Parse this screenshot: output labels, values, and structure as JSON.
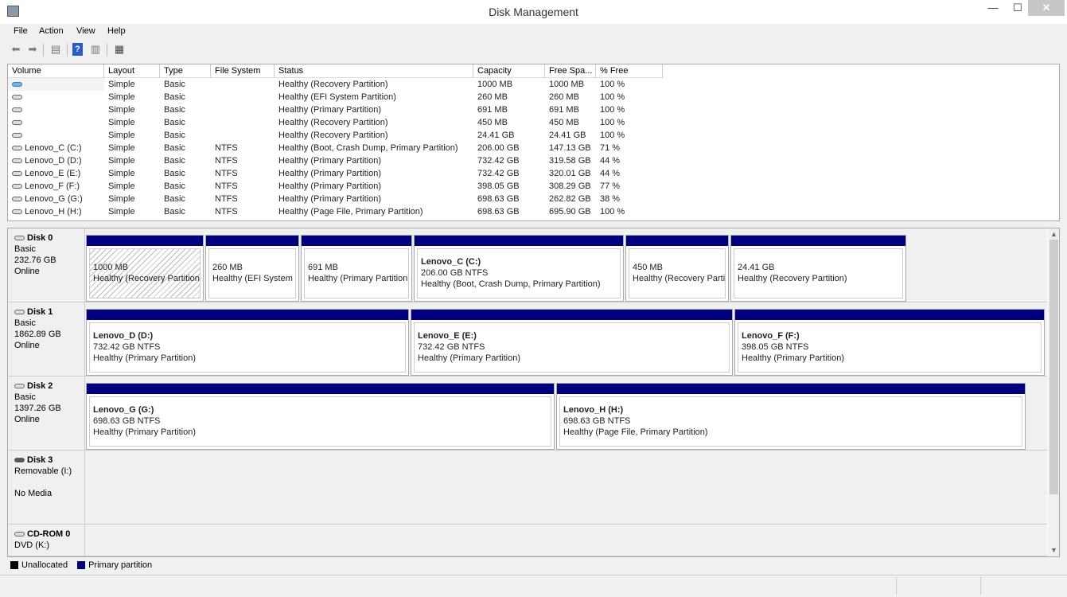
{
  "window": {
    "title": "Disk Management",
    "minimize": "—",
    "maximize": "☐",
    "close": "✕"
  },
  "menu": [
    "File",
    "Action",
    "View",
    "Help"
  ],
  "toolbar": [
    {
      "icon": "back-arrow-icon"
    },
    {
      "icon": "forward-arrow-icon"
    },
    {
      "icon": "console-tree-icon"
    },
    {
      "icon": "help-icon"
    },
    {
      "icon": "action-pane-icon"
    },
    {
      "icon": "properties-icon"
    }
  ],
  "columns": [
    "Volume",
    "Layout",
    "Type",
    "File System",
    "Status",
    "Capacity",
    "Free Spa...",
    "% Free"
  ],
  "volumes": [
    [
      "",
      "Simple",
      "Basic",
      "",
      "Healthy (Recovery Partition)",
      "1000 MB",
      "1000 MB",
      "100 %"
    ],
    [
      "",
      "Simple",
      "Basic",
      "",
      "Healthy (EFI System Partition)",
      "260 MB",
      "260 MB",
      "100 %"
    ],
    [
      "",
      "Simple",
      "Basic",
      "",
      "Healthy (Primary Partition)",
      "691 MB",
      "691 MB",
      "100 %"
    ],
    [
      "",
      "Simple",
      "Basic",
      "",
      "Healthy (Recovery Partition)",
      "450 MB",
      "450 MB",
      "100 %"
    ],
    [
      "",
      "Simple",
      "Basic",
      "",
      "Healthy (Recovery Partition)",
      "24.41 GB",
      "24.41 GB",
      "100 %"
    ],
    [
      "Lenovo_C (C:)",
      "Simple",
      "Basic",
      "NTFS",
      "Healthy (Boot, Crash Dump, Primary Partition)",
      "206.00 GB",
      "147.13 GB",
      "71 %"
    ],
    [
      "Lenovo_D (D:)",
      "Simple",
      "Basic",
      "NTFS",
      "Healthy (Primary Partition)",
      "732.42 GB",
      "319.58 GB",
      "44 %"
    ],
    [
      "Lenovo_E (E:)",
      "Simple",
      "Basic",
      "NTFS",
      "Healthy (Primary Partition)",
      "732.42 GB",
      "320.01 GB",
      "44 %"
    ],
    [
      "Lenovo_F (F:)",
      "Simple",
      "Basic",
      "NTFS",
      "Healthy (Primary Partition)",
      "398.05 GB",
      "308.29 GB",
      "77 %"
    ],
    [
      "Lenovo_G (G:)",
      "Simple",
      "Basic",
      "NTFS",
      "Healthy (Primary Partition)",
      "698.63 GB",
      "262.82 GB",
      "38 %"
    ],
    [
      "Lenovo_H (H:)",
      "Simple",
      "Basic",
      "NTFS",
      "Healthy (Page File, Primary Partition)",
      "698.63 GB",
      "695.90 GB",
      "100 %"
    ]
  ],
  "disks": [
    {
      "name": "Disk 0",
      "lines": [
        "Basic",
        "232.76 GB",
        "Online"
      ],
      "partitions": [
        {
          "name": "",
          "size": "1000 MB",
          "status": "Healthy (Recovery Partition)",
          "selected": true
        },
        {
          "name": "",
          "size": "260 MB",
          "status": "Healthy (EFI System Partition)"
        },
        {
          "name": "",
          "size": "691 MB",
          "status": "Healthy (Primary Partition)"
        },
        {
          "name": "Lenovo_C  (C:)",
          "size": "206.00 GB NTFS",
          "status": "Healthy (Boot, Crash Dump, Primary Partition)"
        },
        {
          "name": "",
          "size": "450 MB",
          "status": "Healthy (Recovery Partition)"
        },
        {
          "name": "",
          "size": "24.41 GB",
          "status": "Healthy (Recovery Partition)"
        }
      ]
    },
    {
      "name": "Disk 1",
      "lines": [
        "Basic",
        "1862.89 GB",
        "Online"
      ],
      "partitions": [
        {
          "name": "Lenovo_D  (D:)",
          "size": "732.42 GB NTFS",
          "status": "Healthy (Primary Partition)"
        },
        {
          "name": "Lenovo_E  (E:)",
          "size": "732.42 GB NTFS",
          "status": "Healthy (Primary Partition)"
        },
        {
          "name": "Lenovo_F  (F:)",
          "size": "398.05 GB NTFS",
          "status": "Healthy (Primary Partition)"
        }
      ]
    },
    {
      "name": "Disk 2",
      "lines": [
        "Basic",
        "1397.26 GB",
        "Online"
      ],
      "partitions": [
        {
          "name": "Lenovo_G  (G:)",
          "size": "698.63 GB NTFS",
          "status": "Healthy (Primary Partition)"
        },
        {
          "name": "Lenovo_H  (H:)",
          "size": "698.63 GB NTFS",
          "status": "Healthy (Page File, Primary Partition)"
        }
      ]
    },
    {
      "name": "Disk 3",
      "lines": [
        "Removable (I:)",
        "",
        "No Media"
      ],
      "partitions": []
    },
    {
      "name": "CD-ROM 0",
      "lines": [
        "DVD (K:)"
      ],
      "partitions": []
    }
  ],
  "legend": [
    {
      "label": "Unallocated",
      "color": "#000000"
    },
    {
      "label": "Primary partition",
      "color": "#00007f"
    }
  ]
}
